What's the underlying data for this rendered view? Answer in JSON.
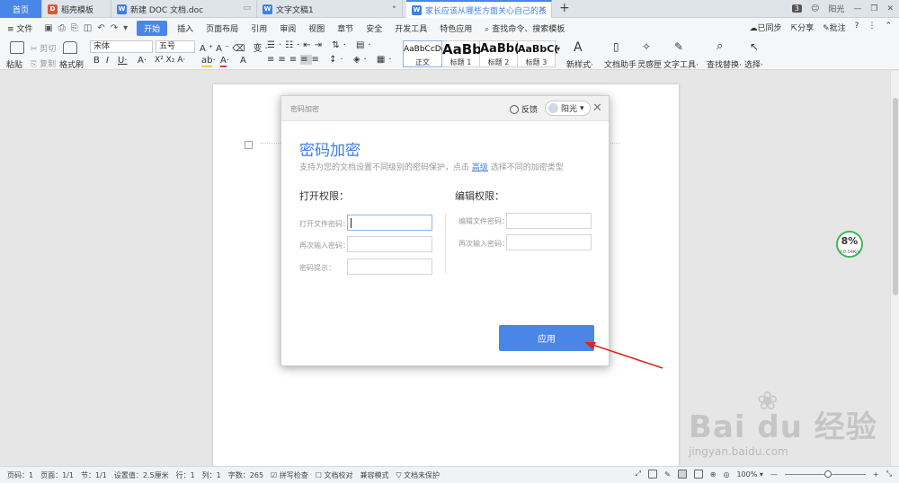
{
  "tabs": [
    {
      "label": "首页",
      "kind": "home"
    },
    {
      "label": "稻壳模板",
      "icon": "daoke-icon",
      "color": "#e0553f"
    },
    {
      "label": "新建 DOC 文档.doc",
      "icon": "wps-doc-icon",
      "color": "#3d7fe6"
    },
    {
      "label": "文字文稿1",
      "icon": "wps-doc-icon",
      "color": "#3d7fe6"
    },
    {
      "label": "家长应该从哪些方面关心自己的孩",
      "icon": "wps-doc-icon",
      "color": "#3d7fe6",
      "active": true
    }
  ],
  "tabbar_right": {
    "badge": "3",
    "user": "阳光"
  },
  "menu": {
    "file": "文件",
    "items": [
      "开始",
      "插入",
      "页面布局",
      "引用",
      "审阅",
      "视图",
      "章节",
      "安全",
      "开发工具",
      "特色应用"
    ],
    "active": "开始",
    "search": "查找命令、搜索模板",
    "right": [
      "已同步",
      "分享",
      "批注",
      "?"
    ]
  },
  "ribbon": {
    "paste": "粘贴",
    "cut": "剪切",
    "copy": "复制",
    "format_painter": "格式刷",
    "font": "宋体",
    "size": "五号",
    "styles": [
      {
        "sample": "AaBbCcDd",
        "label": "正文"
      },
      {
        "sample": "AaBb",
        "label": "标题 1"
      },
      {
        "sample": "AaBb(",
        "label": "标题 2"
      },
      {
        "sample": "AaBbC(",
        "label": "标题 3"
      }
    ],
    "new_style": "新样式",
    "tools": [
      "文档助手",
      "灵感匣",
      "文字工具",
      "查找替换",
      "选择"
    ]
  },
  "speed_widget": {
    "percent": "8%",
    "rate": "↑0.04K/s"
  },
  "dialog": {
    "header_title": "密码加密",
    "feedback": "反馈",
    "user": "阳光",
    "title": "密码加密",
    "description_prefix": "支持为您的文档设置不同级别的密码保护，点击",
    "description_link": "高级",
    "description_suffix": "选择不同的加密类型",
    "open_section": "打开权限：",
    "edit_section": "编辑权限：",
    "open_fields": [
      "打开文件密码：",
      "再次输入密码：",
      "密码提示："
    ],
    "edit_fields": [
      "编辑文件密码：",
      "再次输入密码："
    ],
    "apply_button": "应用"
  },
  "watermark": {
    "logo": "Bai du 经验",
    "url": "jingyan.baidu.com"
  },
  "statusbar": {
    "page": "页码：1",
    "pages": "页面：1/1",
    "section": "节：1/1",
    "setting": "设置值：2.5厘米",
    "row": "行：1",
    "col": "列：1",
    "words": "字数：265",
    "spellcheck": "拼写检查",
    "proofread": "文档校对",
    "compat": "兼容模式",
    "protect": "文档未保护",
    "zoom": "100%"
  }
}
